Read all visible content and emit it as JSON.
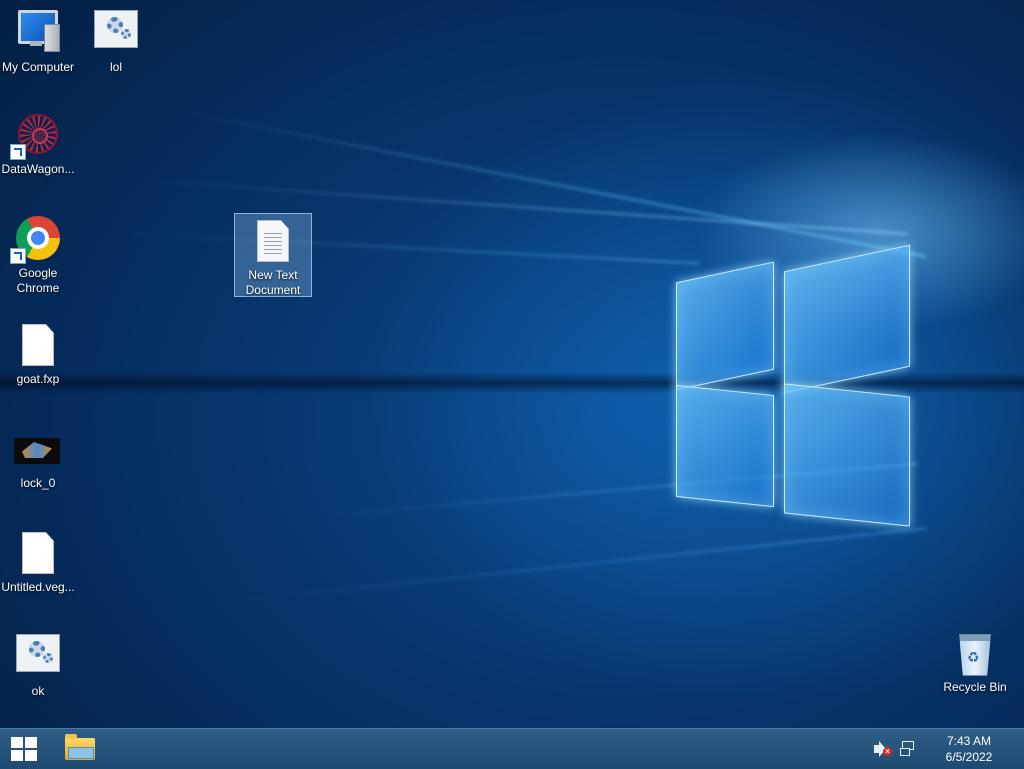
{
  "desktop": {
    "icons": {
      "my_computer": "My Computer",
      "lol": "lol",
      "datawagon": "DataWagon...",
      "new_text_document": "New Text Document",
      "google_chrome": "Google Chrome",
      "goat": "goat.fxp",
      "lock": "lock_0",
      "untitled": "Untitled.veg...",
      "ok": "ok",
      "recycle_bin": "Recycle Bin"
    }
  },
  "taskbar": {
    "start_icon": "windows-logo-icon",
    "pinned": [
      "file-explorer-icon"
    ],
    "tray": {
      "volume_icon": "volume-muted-icon",
      "network_icon": "network-icon",
      "time": "7:43 AM",
      "date": "6/5/2022"
    }
  },
  "colors": {
    "taskbar": "#1e4a72",
    "wallpaper_glow": "#5fc3ff"
  }
}
